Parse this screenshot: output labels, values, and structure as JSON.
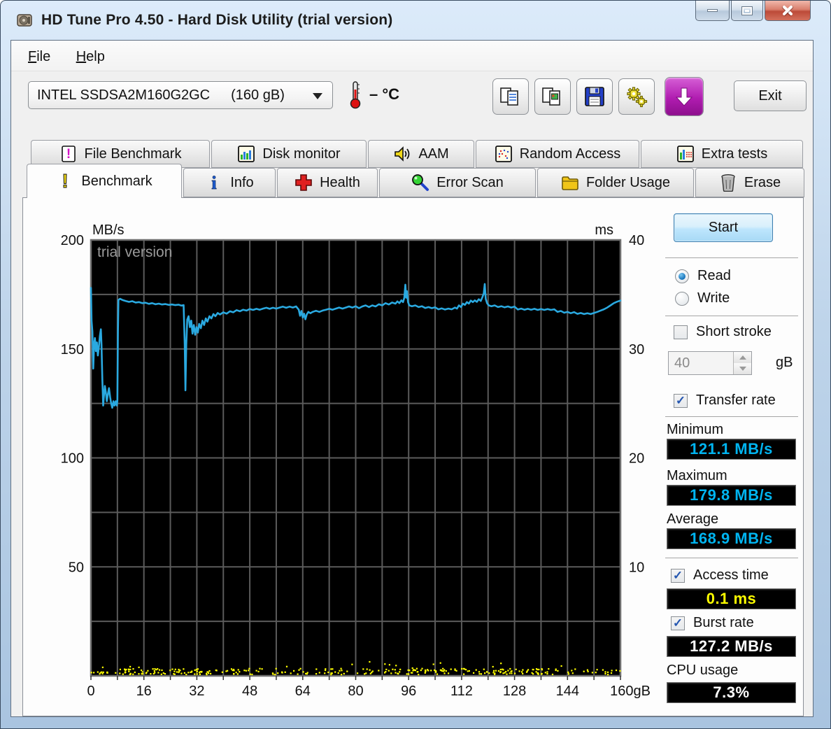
{
  "window": {
    "title": "HD Tune Pro 4.50 - Hard Disk Utility (trial version)"
  },
  "menu": {
    "items": [
      {
        "label": "File"
      },
      {
        "label": "Help"
      }
    ]
  },
  "drive_bar": {
    "drive": {
      "name": "INTEL SSDSA2M160G2GC",
      "capacity": "(160 gB)"
    },
    "temperature": {
      "value": "–",
      "unit": "°C"
    },
    "toolbar_icons": [
      "copy-text-icon",
      "copy-image-icon",
      "save-icon",
      "options-gears-icon",
      "download-arrow-icon"
    ],
    "exit_label": "Exit"
  },
  "tabs": {
    "row1": [
      {
        "label": "File Benchmark"
      },
      {
        "label": "Disk monitor"
      },
      {
        "label": "AAM"
      },
      {
        "label": "Random Access"
      },
      {
        "label": "Extra tests"
      }
    ],
    "row2": [
      {
        "label": "Benchmark",
        "active": true
      },
      {
        "label": "Info"
      },
      {
        "label": "Health"
      },
      {
        "label": "Error Scan"
      },
      {
        "label": "Folder Usage"
      },
      {
        "label": "Erase"
      }
    ]
  },
  "side_panel": {
    "start_label": "Start",
    "read": {
      "label": "Read",
      "selected": true
    },
    "write": {
      "label": "Write",
      "selected": false
    },
    "short_stroke": {
      "label": "Short stroke",
      "checked": false
    },
    "stroke_size": {
      "value": "40",
      "unit": "gB"
    },
    "transfer_rate": {
      "label": "Transfer rate",
      "checked": true
    },
    "minimum": {
      "label": "Minimum",
      "value": "121.1 MB/s",
      "color": "#00b4f0"
    },
    "maximum": {
      "label": "Maximum",
      "value": "179.8 MB/s",
      "color": "#00b4f0"
    },
    "average": {
      "label": "Average",
      "value": "168.9 MB/s",
      "color": "#00b4f0"
    },
    "access_time": {
      "label": "Access time",
      "value": "0.1 ms",
      "checked": true,
      "color": "#ffff00"
    },
    "burst_rate": {
      "label": "Burst rate",
      "value": "127.2 MB/s",
      "checked": true,
      "color": "#ffffff"
    },
    "cpu_usage": {
      "label": "CPU usage",
      "value": "7.3%",
      "color": "#ffffff"
    }
  },
  "chart_data": {
    "type": "line",
    "watermark": "trial version",
    "left_axis": {
      "label": "MB/s",
      "min": 0,
      "max": 200,
      "tick_step": 50,
      "grid_step": 25
    },
    "right_axis": {
      "label": "ms",
      "min": 0,
      "max": 40,
      "tick_step": 10
    },
    "x_axis": {
      "min": 0,
      "max": 160,
      "tick_step": 16,
      "grid_step": 8,
      "last_label_suffix": "gB"
    },
    "grid_color": "#5b5b5b",
    "plot_bg": "#000000",
    "series": [
      {
        "name": "Transfer rate (Read)",
        "unit": "MB/s",
        "color": "#2aa9e0",
        "points": [
          [
            0,
            178
          ],
          [
            0.2,
            163
          ],
          [
            0.45,
            158
          ],
          [
            0.7,
            141
          ],
          [
            0.95,
            152
          ],
          [
            1.2,
            155
          ],
          [
            1.5,
            149
          ],
          [
            1.8,
            153
          ],
          [
            2.1,
            147
          ],
          [
            2.4,
            151
          ],
          [
            2.7,
            156
          ],
          [
            3.0,
            159
          ],
          [
            3.2,
            152
          ],
          [
            3.45,
            136
          ],
          [
            3.7,
            124
          ],
          [
            3.95,
            129
          ],
          [
            4.2,
            133
          ],
          [
            4.5,
            130
          ],
          [
            4.8,
            126
          ],
          [
            5.1,
            129
          ],
          [
            5.45,
            132
          ],
          [
            5.8,
            128
          ],
          [
            6.1,
            125
          ],
          [
            6.45,
            123
          ],
          [
            6.8,
            126
          ],
          [
            7.1,
            124
          ],
          [
            7.5,
            126
          ],
          [
            7.8,
            124
          ],
          [
            8.0,
            126
          ],
          [
            8.15,
            158
          ],
          [
            8.3,
            172.5
          ],
          [
            8.8,
            173
          ],
          [
            9.5,
            172.5
          ],
          [
            10.5,
            172
          ],
          [
            11.5,
            171.6
          ],
          [
            12.5,
            171.9
          ],
          [
            13.5,
            171.3
          ],
          [
            14.5,
            171.5
          ],
          [
            15.5,
            171
          ],
          [
            16.5,
            171.2
          ],
          [
            17.5,
            170.7
          ],
          [
            18.5,
            171
          ],
          [
            19.5,
            170.5
          ],
          [
            20.5,
            170.8
          ],
          [
            21.5,
            170.4
          ],
          [
            22.5,
            170.6
          ],
          [
            23.5,
            170.2
          ],
          [
            24.5,
            170.4
          ],
          [
            25.5,
            170.1
          ],
          [
            26.5,
            170.3
          ],
          [
            27.3,
            169.9
          ],
          [
            28.0,
            170.1
          ],
          [
            28.35,
            152
          ],
          [
            28.55,
            131
          ],
          [
            28.8,
            152
          ],
          [
            29.1,
            163.5
          ],
          [
            29.5,
            165
          ],
          [
            29.9,
            160
          ],
          [
            30.3,
            163
          ],
          [
            30.7,
            157
          ],
          [
            31.1,
            161
          ],
          [
            31.5,
            156.5
          ],
          [
            31.9,
            160
          ],
          [
            32.3,
            157.5
          ],
          [
            32.7,
            161.5
          ],
          [
            33.2,
            159.5
          ],
          [
            33.7,
            163
          ],
          [
            34.2,
            161
          ],
          [
            34.7,
            164
          ],
          [
            35.2,
            162.5
          ],
          [
            35.8,
            165
          ],
          [
            36.4,
            164
          ],
          [
            37,
            166
          ],
          [
            37.6,
            165
          ],
          [
            38.3,
            166.5
          ],
          [
            39,
            165.8
          ],
          [
            40,
            166.8
          ],
          [
            41,
            166.2
          ],
          [
            42,
            167.3
          ],
          [
            43,
            166.8
          ],
          [
            44,
            167.8
          ],
          [
            45,
            167.3
          ],
          [
            46,
            168
          ],
          [
            47,
            167.6
          ],
          [
            48,
            168.3
          ],
          [
            49,
            167.9
          ],
          [
            50,
            168.4
          ],
          [
            51,
            168
          ],
          [
            52,
            168.5
          ],
          [
            53,
            168.9
          ],
          [
            54,
            168.4
          ],
          [
            55,
            168.9
          ],
          [
            56,
            168.5
          ],
          [
            57,
            169
          ],
          [
            58,
            169.4
          ],
          [
            59,
            168.9
          ],
          [
            60,
            169.4
          ],
          [
            61,
            169
          ],
          [
            62,
            169.5
          ],
          [
            62.8,
            168
          ],
          [
            63.2,
            165.2
          ],
          [
            63.6,
            167.4
          ],
          [
            64,
            164.4
          ],
          [
            64.4,
            166.2
          ],
          [
            64.8,
            163.6
          ],
          [
            65.2,
            165.8
          ],
          [
            65.7,
            167
          ],
          [
            66.3,
            166.4
          ],
          [
            67,
            167
          ],
          [
            68,
            167.5
          ],
          [
            69,
            167
          ],
          [
            70,
            167.6
          ],
          [
            71,
            168
          ],
          [
            72,
            168.4
          ],
          [
            73,
            168
          ],
          [
            74,
            168.5
          ],
          [
            75,
            169
          ],
          [
            76,
            168.5
          ],
          [
            77,
            169
          ],
          [
            78,
            169.5
          ],
          [
            79,
            169
          ],
          [
            80,
            169.6
          ],
          [
            81,
            168.7
          ],
          [
            82,
            169.5
          ],
          [
            83,
            170
          ],
          [
            84,
            169.2
          ],
          [
            85,
            170
          ],
          [
            86,
            169.5
          ],
          [
            87,
            170.5
          ],
          [
            88,
            170
          ],
          [
            89,
            171
          ],
          [
            90,
            170.4
          ],
          [
            91,
            171.3
          ],
          [
            92,
            170.8
          ],
          [
            92.6,
            171.8
          ],
          [
            93.2,
            171
          ],
          [
            93.8,
            172.3
          ],
          [
            94.3,
            171.5
          ],
          [
            94.7,
            173.5
          ],
          [
            95,
            179.5
          ],
          [
            95.25,
            173.5
          ],
          [
            95.5,
            176.5
          ],
          [
            95.8,
            171.5
          ],
          [
            96.2,
            170
          ],
          [
            97,
            169.6
          ],
          [
            98,
            170
          ],
          [
            99,
            169.2
          ],
          [
            100,
            169.6
          ],
          [
            101,
            168.8
          ],
          [
            102,
            169.2
          ],
          [
            103,
            168.7
          ],
          [
            104,
            169.1
          ],
          [
            105,
            168.2
          ],
          [
            106,
            168.6
          ],
          [
            107,
            168.1
          ],
          [
            108,
            168.5
          ],
          [
            109,
            168.2
          ],
          [
            110,
            169
          ],
          [
            110.6,
            168.5
          ],
          [
            111.2,
            170
          ],
          [
            111.8,
            169.2
          ],
          [
            112.4,
            170.8
          ],
          [
            113,
            170.2
          ],
          [
            113.6,
            171.5
          ],
          [
            114.2,
            170.8
          ],
          [
            114.8,
            172.2
          ],
          [
            115.4,
            171.5
          ],
          [
            116,
            172.3
          ],
          [
            116.6,
            171.6
          ],
          [
            117.2,
            172.8
          ],
          [
            117.8,
            172
          ],
          [
            118.3,
            173.8
          ],
          [
            118.7,
            175.5
          ],
          [
            119,
            179.8
          ],
          [
            119.3,
            173
          ],
          [
            119.7,
            171
          ],
          [
            120.2,
            170
          ],
          [
            121,
            169.6
          ],
          [
            122,
            170
          ],
          [
            123,
            169.2
          ],
          [
            124,
            169.6
          ],
          [
            125,
            169.1
          ],
          [
            126,
            169.5
          ],
          [
            127,
            169
          ],
          [
            128,
            169.4
          ],
          [
            129,
            168.1
          ],
          [
            130,
            168.5
          ],
          [
            131,
            168
          ],
          [
            132,
            168.4
          ],
          [
            133,
            168
          ],
          [
            134,
            168.4
          ],
          [
            135,
            167.9
          ],
          [
            136,
            168.3
          ],
          [
            137,
            167.9
          ],
          [
            138,
            168.3
          ],
          [
            139,
            167.9
          ],
          [
            140,
            168.2
          ],
          [
            141,
            167
          ],
          [
            142,
            167.4
          ],
          [
            143,
            166.6
          ],
          [
            144,
            167
          ],
          [
            145,
            166.4
          ],
          [
            146,
            166.9
          ],
          [
            147,
            166.1
          ],
          [
            148,
            166.5
          ],
          [
            149,
            166
          ],
          [
            150,
            166.4
          ],
          [
            151,
            166
          ],
          [
            152,
            166.5
          ],
          [
            153,
            167
          ],
          [
            154,
            167.6
          ],
          [
            155,
            168.2
          ],
          [
            156,
            169
          ],
          [
            157,
            170
          ],
          [
            158,
            171
          ],
          [
            159,
            171.7
          ],
          [
            160,
            172.2
          ]
        ]
      }
    ],
    "access_dots": {
      "name": "Access time",
      "unit": "ms",
      "color": "#ffff00",
      "typical_ms": 0.4,
      "count": 340,
      "seed": 20110
    }
  }
}
